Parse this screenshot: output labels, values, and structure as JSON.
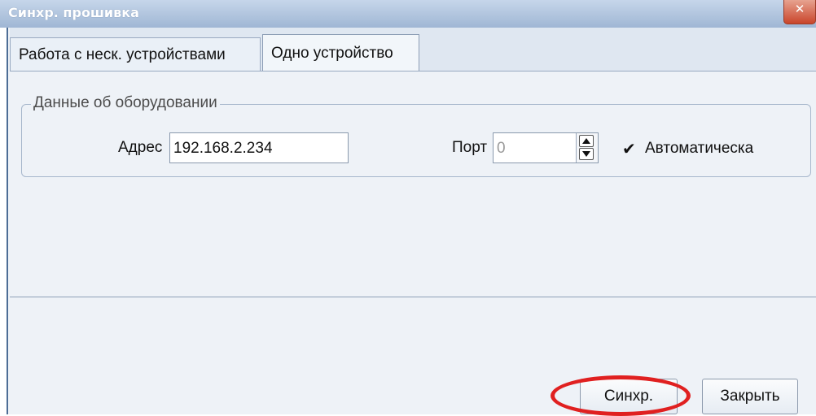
{
  "window": {
    "title": "Синхр. прошивка",
    "close_glyph": "✕"
  },
  "tabs": [
    {
      "label": "Работа с неск. устройствами",
      "active": false
    },
    {
      "label": "Одно устройство",
      "active": true
    }
  ],
  "hardware": {
    "group_title": "Данные об оборудовании",
    "address_label": "Адрес",
    "address_value": "192.168.2.234",
    "port_label": "Порт",
    "port_value": "0",
    "auto_label": "Автоматическа",
    "auto_checked": true,
    "checkmark": "✔"
  },
  "buttons": {
    "sync": "Синхр.",
    "close": "Закрыть"
  },
  "colors": {
    "highlight": "#e02020",
    "titlebar": "#9fb6d4",
    "close_button": "#c9452b"
  },
  "icons": {
    "spin_up": "arrow-up-icon",
    "spin_down": "arrow-down-icon"
  }
}
